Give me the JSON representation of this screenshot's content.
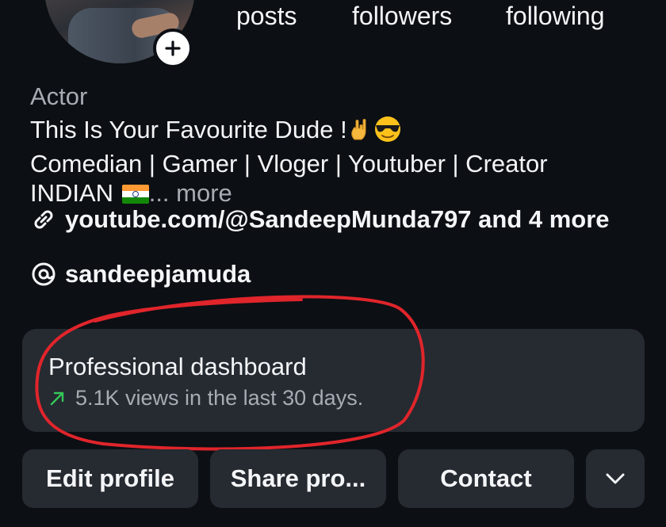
{
  "stats": {
    "posts_label": "posts",
    "followers_label": "followers",
    "following_label": "following"
  },
  "profile": {
    "category": "Actor",
    "bio_line1": "This Is Your Favourite Dude !",
    "bio_line2": "Comedian | Gamer | Vloger | Youtuber | Creator",
    "bio_line3": "INDIAN",
    "bio_more": "... more",
    "link_text": "youtube.com/@SandeepMunda797 and 4 more",
    "threads_handle": "sandeepjamuda"
  },
  "dashboard": {
    "title": "Professional dashboard",
    "subtitle": "5.1K views in the last 30 days."
  },
  "actions": {
    "edit_label": "Edit profile",
    "share_label": "Share pro...",
    "contact_label": "Contact"
  },
  "colors": {
    "background": "#0c0f14",
    "card": "#262a31",
    "annotation": "#e0252b",
    "trend": "#34c759"
  },
  "icons": [
    "add-icon",
    "link-icon",
    "threads-icon",
    "trend-up-icon",
    "chevron-down-icon"
  ]
}
